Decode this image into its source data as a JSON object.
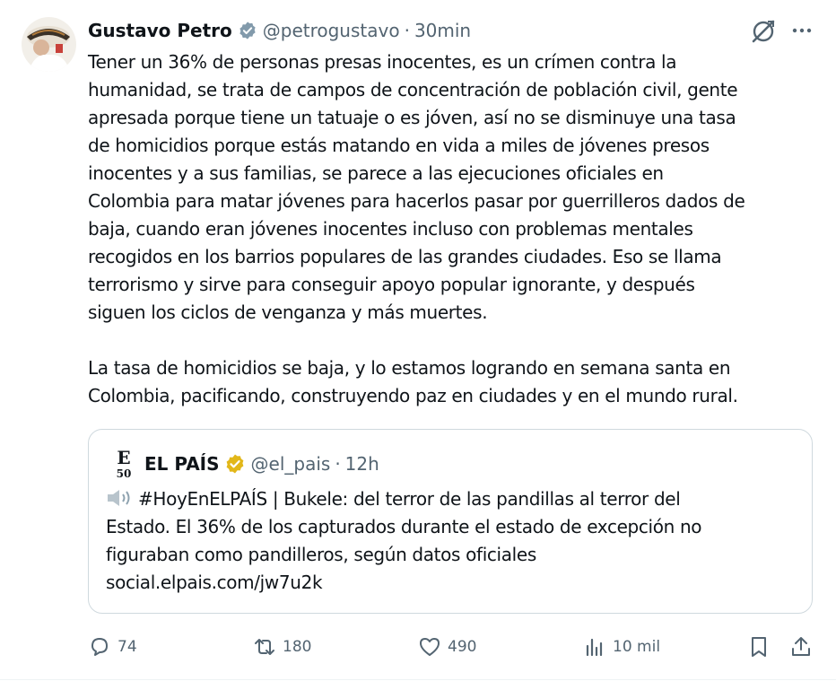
{
  "author": {
    "name": "Gustavo Petro",
    "handle": "@petrogustavo",
    "time": "30min",
    "separator": "·"
  },
  "tweet": {
    "paragraphs": [
      "Tener un 36% de personas presas inocentes, es un crímen contra la\nhumanidad, se trata de campos de concentración de población civil, gente\napresada porque tiene un tatuaje o es jóven, así no se disminuye una tasa\nde homicidios porque estás matando en vida a miles de jóvenes presos\ninocentes y a sus familias, se parece a las ejecuciones oficiales en\nColombia para matar jóvenes para hacerlos pasar por guerrilleros dados de\nbaja, cuando eran jóvenes inocentes incluso con problemas mentales\nrecogidos en los barrios populares de las grandes ciudades. Eso se llama\nterrorismo y sirve para conseguir apoyo popular ignorante, y después\nsiguen los ciclos de venganza y más muertes.",
      "La tasa de homicidios se baja, y lo estamos logrando en semana santa en\nColombia, pacificando,  construyendo paz en ciudades y en el mundo rural."
    ]
  },
  "quote": {
    "name": "EL PAÍS",
    "handle": "@el_pais",
    "time": "12h",
    "separator": "·",
    "logo_text": "E",
    "logo_sub": "50",
    "line1": "#HoyEnELPAÍS | Bukele: del terror de las pandillas al terror del",
    "line2": "Estado. El 36% de los capturados durante el estado de excepción no",
    "line3": "figuraban como pandilleros, según datos oficiales",
    "line4": "social.elpais.com/jw7u2k"
  },
  "actions": {
    "replies": "74",
    "reposts": "180",
    "likes": "490",
    "views": "10 mil"
  },
  "colors": {
    "verified_blue": "#829aab",
    "verified_gold": "#e2b719",
    "muted": "#536471",
    "border": "#cfd9de"
  },
  "icons": [
    "avatar",
    "verified-badge-icon",
    "grok-icon",
    "more-icon",
    "verified-gold-icon",
    "speaker-icon",
    "reply-icon",
    "repost-icon",
    "like-icon",
    "views-icon",
    "bookmark-icon",
    "share-icon"
  ]
}
